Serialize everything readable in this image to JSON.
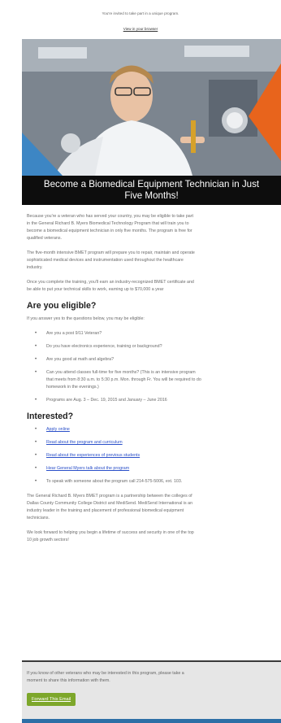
{
  "email": {
    "preheader": "You're invited to take part in a unique program.",
    "view_in_browser": "View in your browser",
    "headline_line1": "Become a Biomedical Equipment Technician in Just",
    "headline_line2": "Five Months!",
    "intro_paragraphs": [
      "Because you're a veteran who has served your country, you may be eligible to take part\nin the General Richard B. Myers Biomedical Technology Program that will train you to\nbecome a biomedical equipment technician in only five months. The program is free for\nqualified veterans.",
      "The five-month intensive BMET program will prepare you to repair, maintain and operate\nsophisticated medical devices and instrumentation used throughout the healthcare\nindustry.",
      "Once you complete the training, you'll earn an industry-recognized BMET certificate and\nbe able to put your technical skills to work, earning up to $70,000 a year"
    ],
    "eligible_heading": "Are you eligible?",
    "eligible_intro": "If you answer yes to the questions below, you may be eligible:",
    "eligible_items": [
      "Are you a post 9/11 Veteran?",
      "Do you have electronics experience, training or background?",
      "Are you good at math and algebra?",
      "Can you attend classes full-time for five months? (This is an intensive program\nthat meets from 8:30 a.m. to 5:30 p.m. Mon. through Fr. You will be required to do\nhomework in the evenings.)",
      "Programs are Aug. 3 – Dec. 19, 2015 and January – June 2016"
    ],
    "interested_heading": "Interested?",
    "links": [
      "Apply online",
      "Read about the program and curriculum",
      "Read about the experiences of previous students",
      "Hear General Myers talk about the program"
    ],
    "phone_item": "To speak with someone about the program call 214-575-5006, ext. 103.",
    "closing_paragraphs": [
      "The General Richard B. Myers BMET program is a partnership between the colleges of\nDallas County Community College District and MediSend. MediSend International is an\nindustry leader in the training and placement of professional biomedical equipment\ntechnicians.",
      "We look forward to helping you begin a lifetime of success and security in one of the top\n10 job growth sectors!"
    ],
    "footer_text": "If you know of other veterans who may be interested in this program, please take a\nmoment to share this information with them.",
    "forward_button": "Forward This Email"
  },
  "colors": {
    "headline_bg": "#0d0d0d",
    "link": "#2b50c9",
    "button": "#7da72b",
    "footer_bar": "#2d6fa6",
    "accent_orange": "#e8641c",
    "accent_blue": "#3d86c4"
  }
}
